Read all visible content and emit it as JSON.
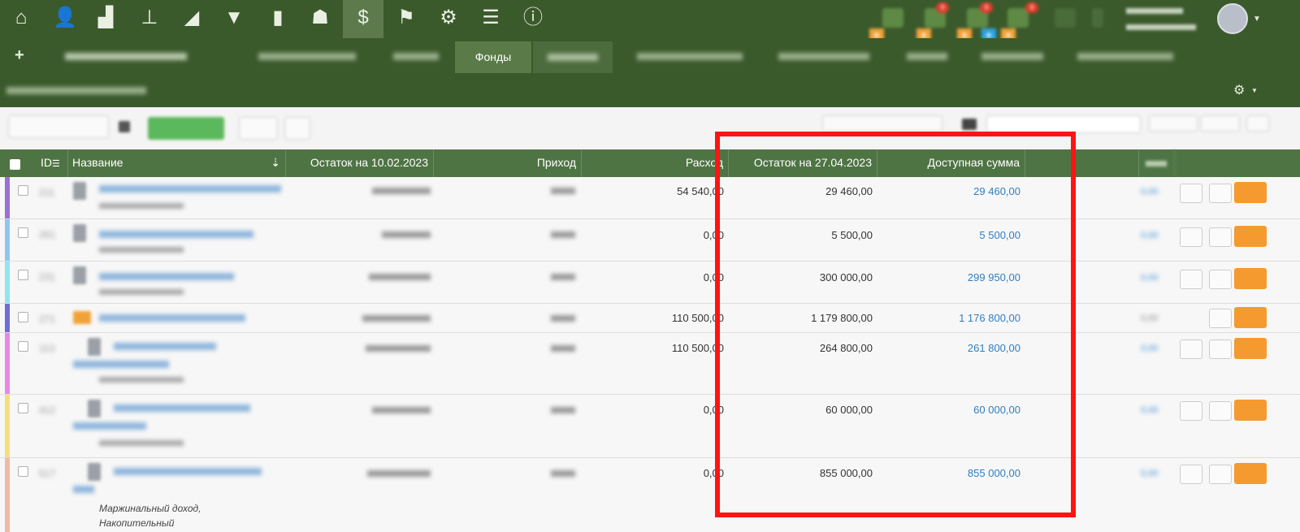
{
  "nav": {
    "icons": [
      "home-icon",
      "users-icon",
      "factory-icon",
      "hierarchy-icon",
      "chart-area-icon",
      "filter-icon",
      "bar-chart-icon",
      "hat-icon",
      "money-bag-icon",
      "flag-icon",
      "gear-icon",
      "list-icon",
      "info-icon"
    ],
    "badges": [
      "9",
      "9",
      "9"
    ],
    "user_line1": "",
    "user_line2": ""
  },
  "tabs": {
    "plus": "+",
    "period": "",
    "items": [
      "",
      "",
      "Фонды",
      "",
      "",
      "",
      "",
      "",
      ""
    ],
    "second_line": ""
  },
  "toolbar": {
    "search_placeholder": ""
  },
  "table": {
    "headers": {
      "id": "ID",
      "name": "Название",
      "balance_start": "Остаток на 10.02.2023",
      "income": "Приход",
      "expense": "Расход",
      "balance_end": "Остаток на 27.04.2023",
      "available": "Доступная сумма"
    },
    "rows": [
      {
        "expense": "54 540,00",
        "balance_end": "29 460,00",
        "available": "29 460,00",
        "stripe": "#9b6fd6"
      },
      {
        "expense": "0,00",
        "balance_end": "5 500,00",
        "available": "5 500,00",
        "stripe": "#8fc6f0"
      },
      {
        "expense": "0,00",
        "balance_end": "300 000,00",
        "available": "299 950,00",
        "stripe": "#8fe6f0"
      },
      {
        "expense": "110 500,00",
        "balance_end": "1 179 800,00",
        "available": "1 176 800,00",
        "stripe": "#6d6cd8"
      },
      {
        "expense": "110 500,00",
        "balance_end": "264 800,00",
        "available": "261 800,00",
        "stripe": "#e987e6"
      },
      {
        "expense": "0,00",
        "balance_end": "60 000,00",
        "available": "60 000,00",
        "stripe": "#f4df7a"
      },
      {
        "expense": "0,00",
        "balance_end": "855 000,00",
        "available": "855 000,00",
        "stripe": "#f1b9a5",
        "note1": "Маржинальный доход,",
        "note2": "Накопительный"
      }
    ]
  },
  "colors": {
    "header_green": "#3b5a2c",
    "table_header": "#4f7444",
    "highlight": "#ff1414",
    "link": "#2f7fc0"
  }
}
